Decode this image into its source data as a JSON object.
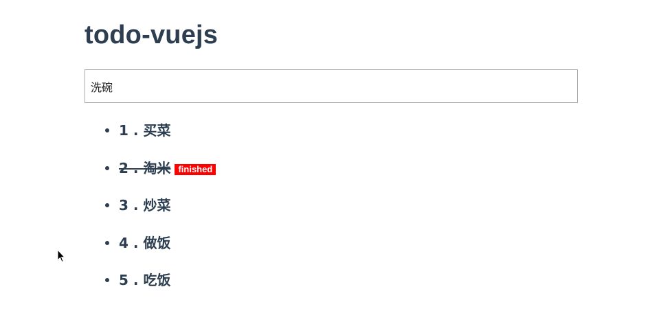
{
  "app": {
    "title": "todo-vuejs"
  },
  "input": {
    "value": "洗碗"
  },
  "todos": [
    {
      "label": "1 . 买菜",
      "finished": false
    },
    {
      "label": "2 . 淘米",
      "finished": true,
      "badge": "finished"
    },
    {
      "label": "3 . 炒菜",
      "finished": false
    },
    {
      "label": "4 . 做饭",
      "finished": false
    },
    {
      "label": "5 . 吃饭",
      "finished": false
    }
  ],
  "colors": {
    "text": "#2c3e50",
    "badge_bg": "#ff0000",
    "badge_text": "#ffffff",
    "input_border": "#a9a9a9"
  },
  "icons": {
    "cursor": "mouse-pointer-icon"
  }
}
